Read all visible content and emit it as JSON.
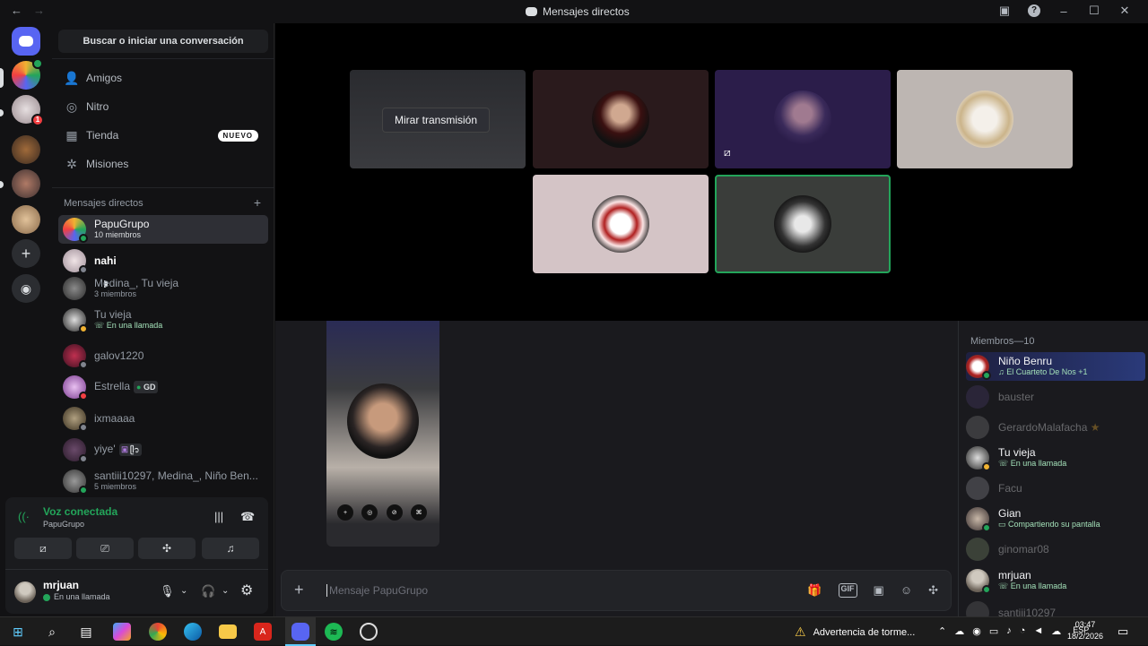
{
  "window": {
    "title": "Mensajes directos",
    "nav_back": "←",
    "nav_fwd": "→"
  },
  "sidebar": {
    "search_label": "Buscar o iniciar una conversación",
    "nav": [
      {
        "label": "Amigos",
        "icon": "friends-icon"
      },
      {
        "label": "Nitro",
        "icon": "nitro-icon"
      },
      {
        "label": "Tienda",
        "icon": "shop-icon",
        "badge": "NUEVO"
      },
      {
        "label": "Misiones",
        "icon": "quests-icon"
      }
    ],
    "dm_header": "Mensajes directos",
    "dm_add": "+",
    "dms": [
      {
        "name": "PapuGrupo",
        "sub": "10 miembros"
      },
      {
        "name": "nahi",
        "sub": ""
      },
      {
        "name": "Medina_, Tu vieja",
        "sub": "3 miembros"
      },
      {
        "name": "Tu vieja",
        "sub": "En una llamada"
      },
      {
        "name": "galov1220",
        "sub": ""
      },
      {
        "name": "Estrella",
        "sub": "",
        "tag": "GD"
      },
      {
        "name": "ixmaaaa",
        "sub": ""
      },
      {
        "name": "yiye'",
        "sub": "",
        "tag": "ᥫ᭡"
      },
      {
        "name": "santiii10297, Medina_, Niño Ben...",
        "sub": "5 miembros"
      }
    ]
  },
  "voice": {
    "status": "Voz conectada",
    "channel": "PapuGrupo",
    "user": {
      "name": "mrjuan",
      "status": "En una llamada"
    }
  },
  "stage": {
    "watch_label": "Mirar transmisión"
  },
  "chat": {
    "placeholder": "Mensaje PapuGrupo",
    "add": "+"
  },
  "members": {
    "header": "Miembros—10",
    "list": [
      {
        "name": "Niño Benru",
        "sub": "El Cuarteto De Nos +1",
        "online": true
      },
      {
        "name": "bauster",
        "sub": "",
        "online": false
      },
      {
        "name": "GerardoMalafacha",
        "sub": "",
        "online": false
      },
      {
        "name": "Tu vieja",
        "sub": "En una llamada",
        "online": true
      },
      {
        "name": "Facu",
        "sub": "",
        "online": false
      },
      {
        "name": "Gian",
        "sub": "Compartiendo su pantalla",
        "online": true
      },
      {
        "name": "ginomar08",
        "sub": "",
        "online": false
      },
      {
        "name": "mrjuan",
        "sub": "En una llamada",
        "online": true
      },
      {
        "name": "santiii10297",
        "sub": "",
        "online": false
      }
    ]
  },
  "taskbar": {
    "warning": "Advertencia de torme...",
    "lang": "ESP",
    "time": "03:47",
    "date": "18/2/2026"
  },
  "colors": {
    "online": "#23a55a",
    "accent": "#5865f2",
    "danger": "#f23f42"
  }
}
